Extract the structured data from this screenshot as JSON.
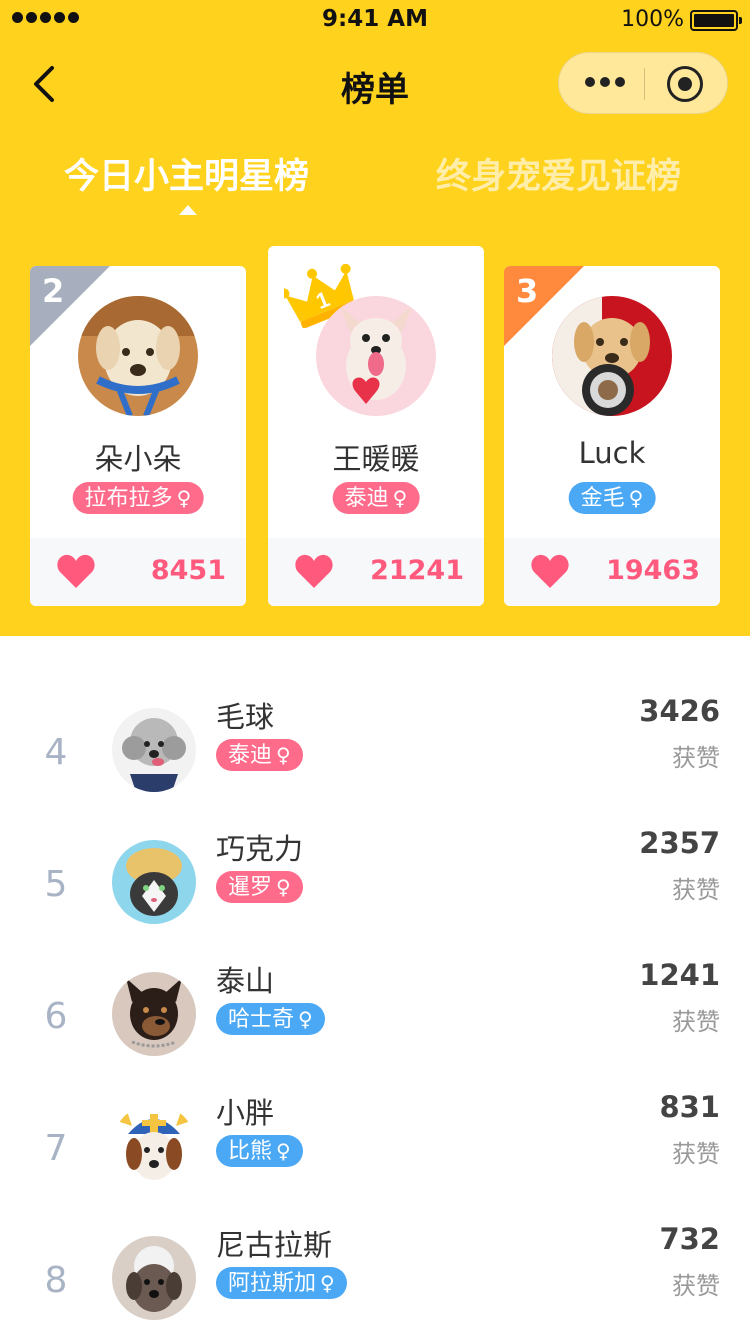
{
  "status_bar": {
    "time": "9:41 AM",
    "battery": "100%"
  },
  "nav": {
    "title": "榜单"
  },
  "tabs": [
    {
      "label": "今日小主明星榜",
      "active": true
    },
    {
      "label": "终身宠爱见证榜",
      "active": false
    }
  ],
  "podium": [
    {
      "rank": "2",
      "name": "朵小朵",
      "breed": "拉布拉多",
      "gender_symbol": "♀",
      "votes": "8451",
      "tag_color": "#FF6B8A"
    },
    {
      "rank": "1",
      "name": "王暖暖",
      "breed": "泰迪",
      "gender_symbol": "♀",
      "votes": "21241",
      "tag_color": "#FF6B8A"
    },
    {
      "rank": "3",
      "name": "Luck",
      "breed": "金毛",
      "gender_symbol": "♀",
      "votes": "19463",
      "tag_color": "#4AA8F5"
    }
  ],
  "ranking": [
    {
      "rank": "4",
      "name": "毛球",
      "breed": "泰迪",
      "gender_symbol": "♀",
      "score": "3426",
      "score_label": "获赞",
      "tag_color": "#FF6B8A"
    },
    {
      "rank": "5",
      "name": "巧克力",
      "breed": "暹罗",
      "gender_symbol": "♀",
      "score": "2357",
      "score_label": "获赞",
      "tag_color": "#FF6B8A"
    },
    {
      "rank": "6",
      "name": "泰山",
      "breed": "哈士奇",
      "gender_symbol": "♀",
      "score": "1241",
      "score_label": "获赞",
      "tag_color": "#4AA8F5"
    },
    {
      "rank": "7",
      "name": "小胖",
      "breed": "比熊",
      "gender_symbol": "♀",
      "score": "831",
      "score_label": "获赞",
      "tag_color": "#4AA8F5"
    },
    {
      "rank": "8",
      "name": "尼古拉斯",
      "breed": "阿拉斯加",
      "gender_symbol": "♀",
      "score": "732",
      "score_label": "获赞",
      "tag_color": "#4AA8F5"
    }
  ],
  "colors": {
    "header": "#FFD21E",
    "heart": "#FF5A7E",
    "tag_pink": "#FF6B8A",
    "tag_blue": "#4AA8F5"
  }
}
